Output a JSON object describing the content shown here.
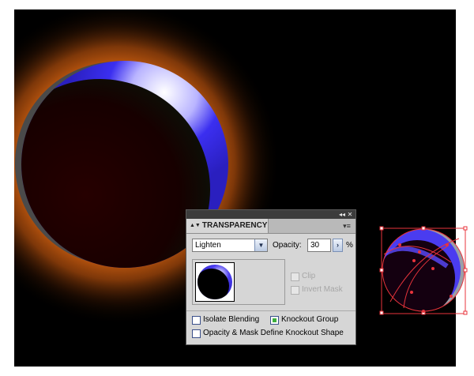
{
  "panel": {
    "title": "TRANSPARENCY",
    "collapse_icon": "double-left-arrow",
    "close_icon": "close-x",
    "menu_icon": "panel-menu",
    "blend_mode": "Lighten",
    "opacity_label": "Opacity:",
    "opacity_value": "30",
    "opacity_unit": "%",
    "clip_label": "Clip",
    "invert_mask_label": "Invert Mask",
    "isolate_blending_label": "Isolate Blending",
    "knockout_group_label": "Knockout Group",
    "opacity_mask_label": "Opacity & Mask Define Knockout Shape",
    "isolate_blending_checked": false,
    "knockout_group_checked": true,
    "opacity_mask_checked": false,
    "clip_enabled": false,
    "invert_mask_enabled": false
  },
  "colors": {
    "artboard_bg": "#000000",
    "glow": "#c2570f",
    "crescent": "#3a2ee0",
    "dark_disc": "#1c0000",
    "selection": "#e8343c"
  }
}
